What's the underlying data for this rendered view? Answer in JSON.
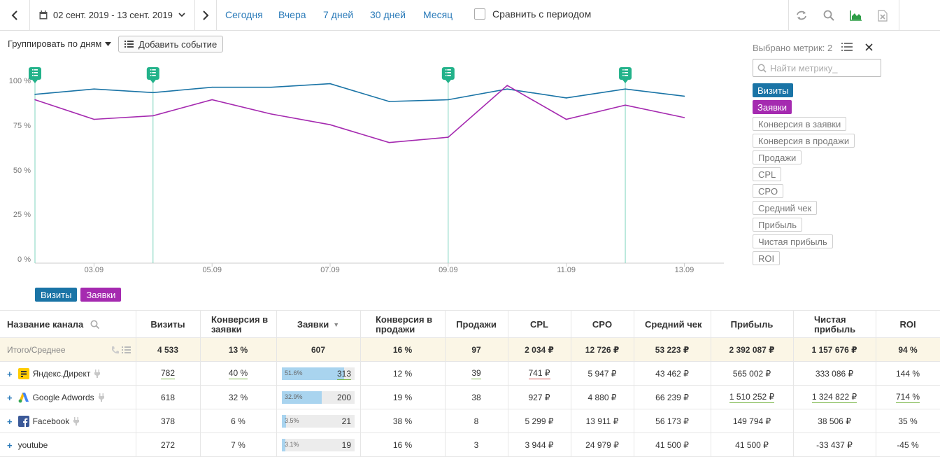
{
  "toolbar": {
    "date_range": "02 сент. 2019 - 13 сент. 2019",
    "periods": [
      "Сегодня",
      "Вчера",
      "7 дней",
      "30 дней",
      "Месяц"
    ],
    "compare_label": "Сравнить с периодом"
  },
  "groupbar": {
    "group_label": "Группировать по дням",
    "add_event_label": "Добавить событие"
  },
  "chart_data": {
    "type": "line",
    "x": [
      "02.09",
      "03.09",
      "04.09",
      "05.09",
      "06.09",
      "07.09",
      "08.09",
      "09.09",
      "10.09",
      "11.09",
      "12.09",
      "13.09"
    ],
    "xtick_labels": [
      "03.09",
      "05.09",
      "07.09",
      "09.09",
      "11.09",
      "13.09"
    ],
    "ytick_labels": [
      "100 %",
      "75 %",
      "50 %",
      "25 %",
      "0 %"
    ],
    "ylim": [
      0,
      100
    ],
    "series": [
      {
        "name": "Визиты",
        "color": "#1a74a6",
        "values": [
          93,
          96,
          94,
          97,
          97,
          99,
          89,
          90,
          96,
          91,
          96,
          92
        ]
      },
      {
        "name": "Заявки",
        "color": "#a52ab0",
        "values": [
          90,
          79,
          81,
          90,
          82,
          76,
          66,
          69,
          98,
          79,
          87,
          80
        ]
      }
    ],
    "event_markers": [
      "02.09",
      "04.09",
      "09.09",
      "12.09"
    ],
    "grid": false
  },
  "legend": [
    {
      "label": "Визиты",
      "color": "#1a74a6"
    },
    {
      "label": "Заявки",
      "color": "#a52ab0"
    }
  ],
  "metrics_panel": {
    "header": "Выбрано метрик: 2",
    "search_placeholder": "Найти метрику_",
    "selected": [
      {
        "label": "Визиты",
        "color": "#1a74a6"
      },
      {
        "label": "Заявки",
        "color": "#a52ab0"
      }
    ],
    "available": [
      "Конверсия в заявки",
      "Конверсия в продажи",
      "Продажи",
      "CPL",
      "CPO",
      "Средний чек",
      "Прибыль",
      "Чистая прибыль",
      "ROI"
    ]
  },
  "table": {
    "headers": [
      "Название канала",
      "Визиты",
      "Конверсия в заявки",
      "Заявки",
      "Конверсия в продажи",
      "Продажи",
      "CPL",
      "CPO",
      "Средний чек",
      "Прибыль",
      "Чистая прибыль",
      "ROI"
    ],
    "sort_indicator": "▼",
    "total": {
      "label": "Итого/Среднее",
      "values": [
        "4 533",
        "13 %",
        "607",
        "16 %",
        "97",
        "2 034 ₽",
        "12 726 ₽",
        "53 223 ₽",
        "2 392 087 ₽",
        "1 157 676 ₽",
        "94 %"
      ]
    },
    "rows": [
      {
        "channel": "Яндекс.Директ",
        "logo": "yandex-direct-icon",
        "visits": "782",
        "conv_leads": "40 %",
        "leads_pct": "51.6%",
        "leads_share": 0.516,
        "leads": "313",
        "conv_sales": "12 %",
        "sales": "39",
        "cpl": "741 ₽",
        "cpo": "5 947 ₽",
        "avg_check": "43 462 ₽",
        "profit": "565 002 ₽",
        "net_profit": "333 086 ₽",
        "roi": "144 %"
      },
      {
        "channel": "Google Adwords",
        "logo": "google-adwords-icon",
        "visits": "618",
        "conv_leads": "32 %",
        "leads_pct": "32.9%",
        "leads_share": 0.329,
        "leads": "200",
        "conv_sales": "19 %",
        "sales": "38",
        "cpl": "927 ₽",
        "cpo": "4 880 ₽",
        "avg_check": "66 239 ₽",
        "profit": "1 510 252 ₽",
        "net_profit": "1 324 822 ₽",
        "roi": "714 %"
      },
      {
        "channel": "Facebook",
        "logo": "facebook-icon",
        "visits": "378",
        "conv_leads": "6 %",
        "leads_pct": "3.5%",
        "leads_share": 0.035,
        "leads": "21",
        "conv_sales": "38 %",
        "sales": "8",
        "cpl": "5 299 ₽",
        "cpo": "13 911 ₽",
        "avg_check": "56 173 ₽",
        "profit": "149 794 ₽",
        "net_profit": "38 506 ₽",
        "roi": "35 %"
      },
      {
        "channel": "youtube",
        "logo": "",
        "visits": "272",
        "conv_leads": "7 %",
        "leads_pct": "3.1%",
        "leads_share": 0.031,
        "leads": "19",
        "conv_sales": "16 %",
        "sales": "3",
        "cpl": "3 944 ₽",
        "cpo": "24 979 ₽",
        "avg_check": "41 500 ₽",
        "profit": "41 500 ₽",
        "net_profit": "-33 437 ₽",
        "roi": "-45 %"
      }
    ]
  }
}
